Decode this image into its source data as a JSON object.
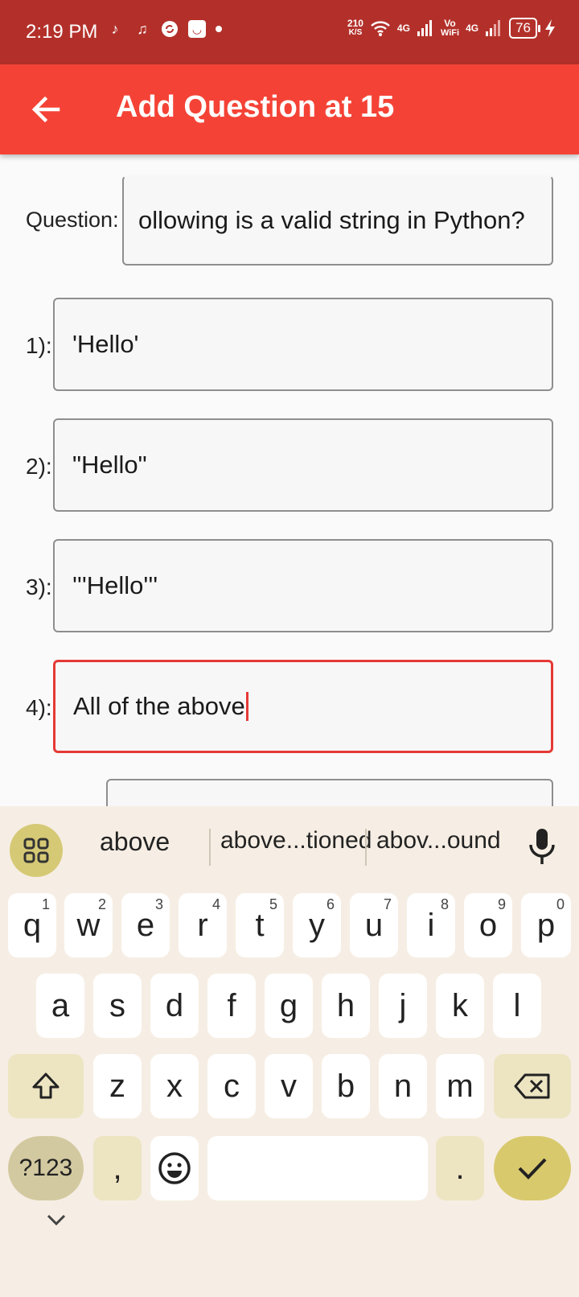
{
  "status_bar": {
    "time": "2:19 PM",
    "speed_value": "210",
    "speed_unit": "K/S",
    "network_1": "4G",
    "vo_wifi_top": "Vo",
    "vo_wifi_bottom": "WiFi",
    "network_2": "4G",
    "battery": "76",
    "icons": [
      "tiktok-icon",
      "music-icon",
      "sync-app-icon",
      "mail-app-icon",
      "notification-dot-icon",
      "wifi-icon",
      "signal-icon",
      "charging-icon"
    ]
  },
  "app_bar": {
    "title": "Add Question at 15",
    "back_icon": "arrow-back-icon",
    "color": "#f44336"
  },
  "form": {
    "question_label": "Question:",
    "question_value": "ollowing is a valid string in Python?",
    "options": [
      {
        "label": "1):",
        "value": "'Hello'"
      },
      {
        "label": "2):",
        "value": "\"Hello\""
      },
      {
        "label": "3):",
        "value": "'''Hello'''"
      },
      {
        "label": "4):",
        "value": "All of the above"
      }
    ]
  },
  "keyboard": {
    "suggestions": [
      "above",
      "above...tioned",
      "abov...ound"
    ],
    "row1": [
      {
        "key": "q",
        "hint": "1"
      },
      {
        "key": "w",
        "hint": "2"
      },
      {
        "key": "e",
        "hint": "3"
      },
      {
        "key": "r",
        "hint": "4"
      },
      {
        "key": "t",
        "hint": "5"
      },
      {
        "key": "y",
        "hint": "6"
      },
      {
        "key": "u",
        "hint": "7"
      },
      {
        "key": "i",
        "hint": "8"
      },
      {
        "key": "o",
        "hint": "9"
      },
      {
        "key": "p",
        "hint": "0"
      }
    ],
    "row2": [
      "a",
      "s",
      "d",
      "f",
      "g",
      "h",
      "j",
      "k",
      "l"
    ],
    "row3": [
      "z",
      "x",
      "c",
      "v",
      "b",
      "n",
      "m"
    ],
    "symbols_label": "?123",
    "comma": ",",
    "period": ".",
    "accent_color": "#d8c96d"
  }
}
